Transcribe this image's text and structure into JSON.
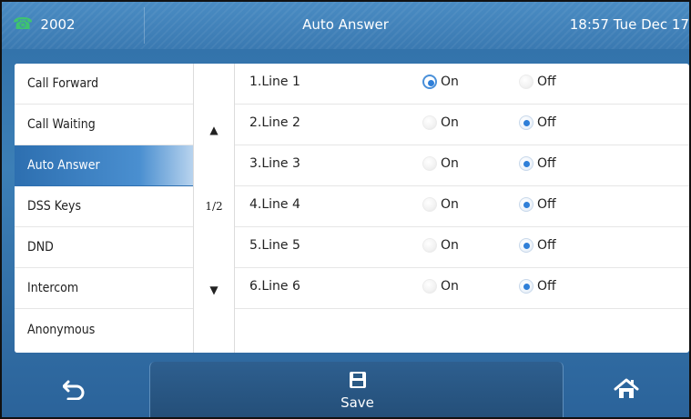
{
  "status_bar": {
    "account": "2002",
    "title": "Auto Answer",
    "clock": "18:57 Tue Dec 17"
  },
  "menu": [
    {
      "label": "Call Forward",
      "active": false
    },
    {
      "label": "Call Waiting",
      "active": false
    },
    {
      "label": "Auto Answer",
      "active": true
    },
    {
      "label": "DSS Keys",
      "active": false
    },
    {
      "label": "DND",
      "active": false
    },
    {
      "label": "Intercom",
      "active": false
    },
    {
      "label": "Anonymous",
      "active": false
    }
  ],
  "pager": {
    "up_glyph": "▲",
    "page": "1/2",
    "down_glyph": "▼"
  },
  "lines": [
    {
      "label": "1.Line 1",
      "on_label": "On",
      "off_label": "Off",
      "selected": "On"
    },
    {
      "label": "2.Line 2",
      "on_label": "On",
      "off_label": "Off",
      "selected": "Off"
    },
    {
      "label": "3.Line 3",
      "on_label": "On",
      "off_label": "Off",
      "selected": "Off"
    },
    {
      "label": "4.Line 4",
      "on_label": "On",
      "off_label": "Off",
      "selected": "Off"
    },
    {
      "label": "5.Line 5",
      "on_label": "On",
      "off_label": "Off",
      "selected": "Off"
    },
    {
      "label": "6.Line 6",
      "on_label": "On",
      "off_label": "Off",
      "selected": "Off"
    }
  ],
  "softkeys": {
    "back_icon": "back-icon",
    "save_label": "Save",
    "save_icon": "save-icon",
    "home_icon": "home-icon"
  },
  "colors": {
    "accent_blue": "#2f7fd8",
    "status_green": "#3ec36f",
    "active_menu": "#2d6fb0"
  }
}
